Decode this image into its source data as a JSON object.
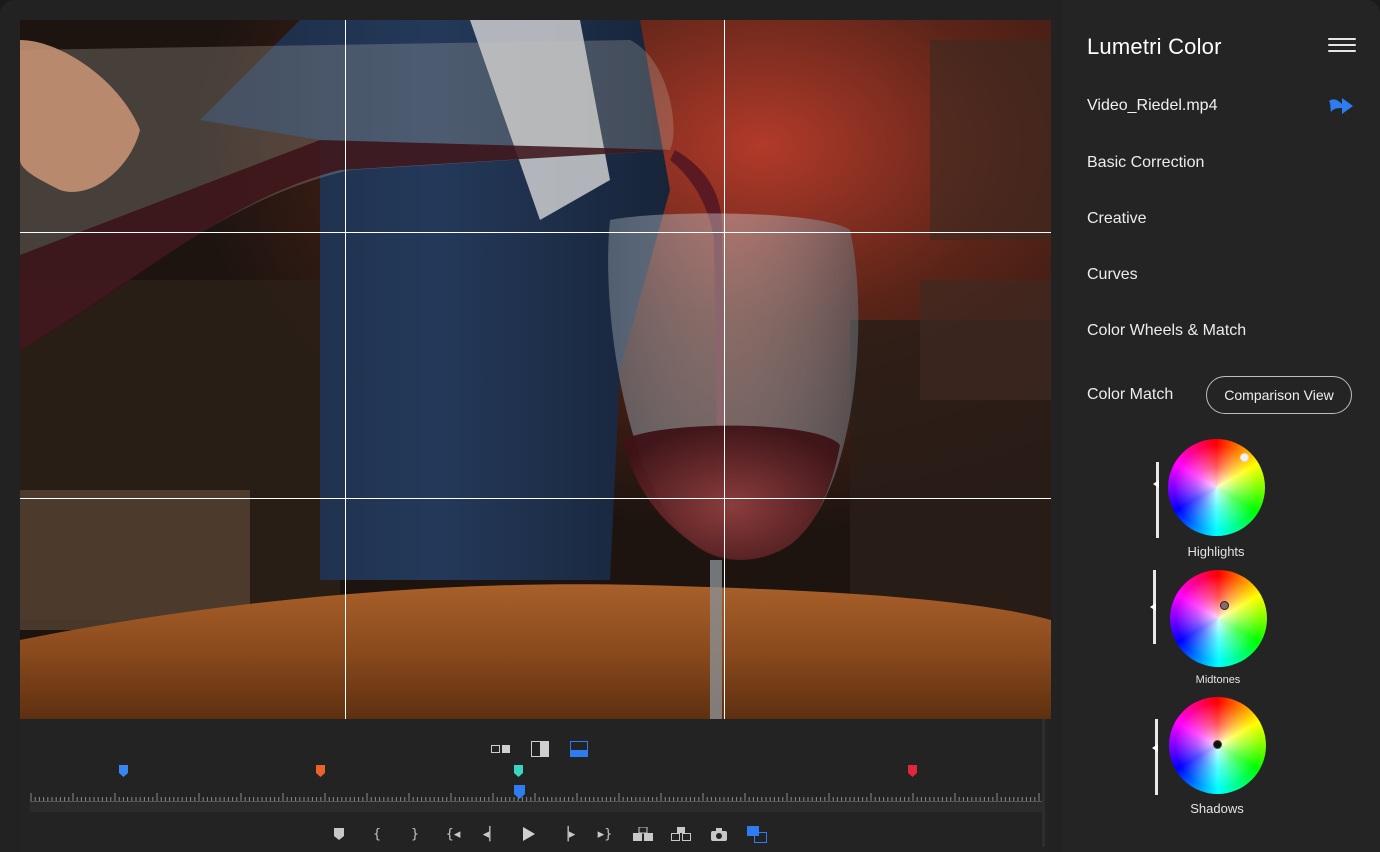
{
  "panel": {
    "title": "Lumetri Color",
    "clip_name": "Video_Riedel.mp4",
    "sections": [
      "Basic Correction",
      "Creative",
      "Curves",
      "Color Wheels & Match"
    ],
    "color_match_label": "Color Match",
    "comparison_view_label": "Comparison View",
    "wheels": [
      {
        "label": "Highlights"
      },
      {
        "label": "Midtones"
      },
      {
        "label": "Shadows"
      }
    ]
  },
  "icons": {
    "menu": "hamburger-menu-icon",
    "clip_action": "curved-arrow-icon",
    "view_modes": [
      "side-by-side-icon",
      "split-view-icon",
      "top-bottom-icon"
    ],
    "transport": [
      "add-marker-icon",
      "mark-in-icon",
      "mark-out-icon",
      "go-to-in-icon",
      "step-back-icon",
      "play-icon",
      "step-forward-icon",
      "go-to-out-icon",
      "insert-icon",
      "overwrite-icon",
      "export-frame-icon",
      "comparison-toggle-icon"
    ]
  },
  "colors": {
    "accent": "#2d7cf2",
    "marker_blue": "#3a86f0",
    "marker_orange": "#e8622c",
    "marker_teal": "#39d6c4",
    "marker_red": "#e0283a"
  }
}
